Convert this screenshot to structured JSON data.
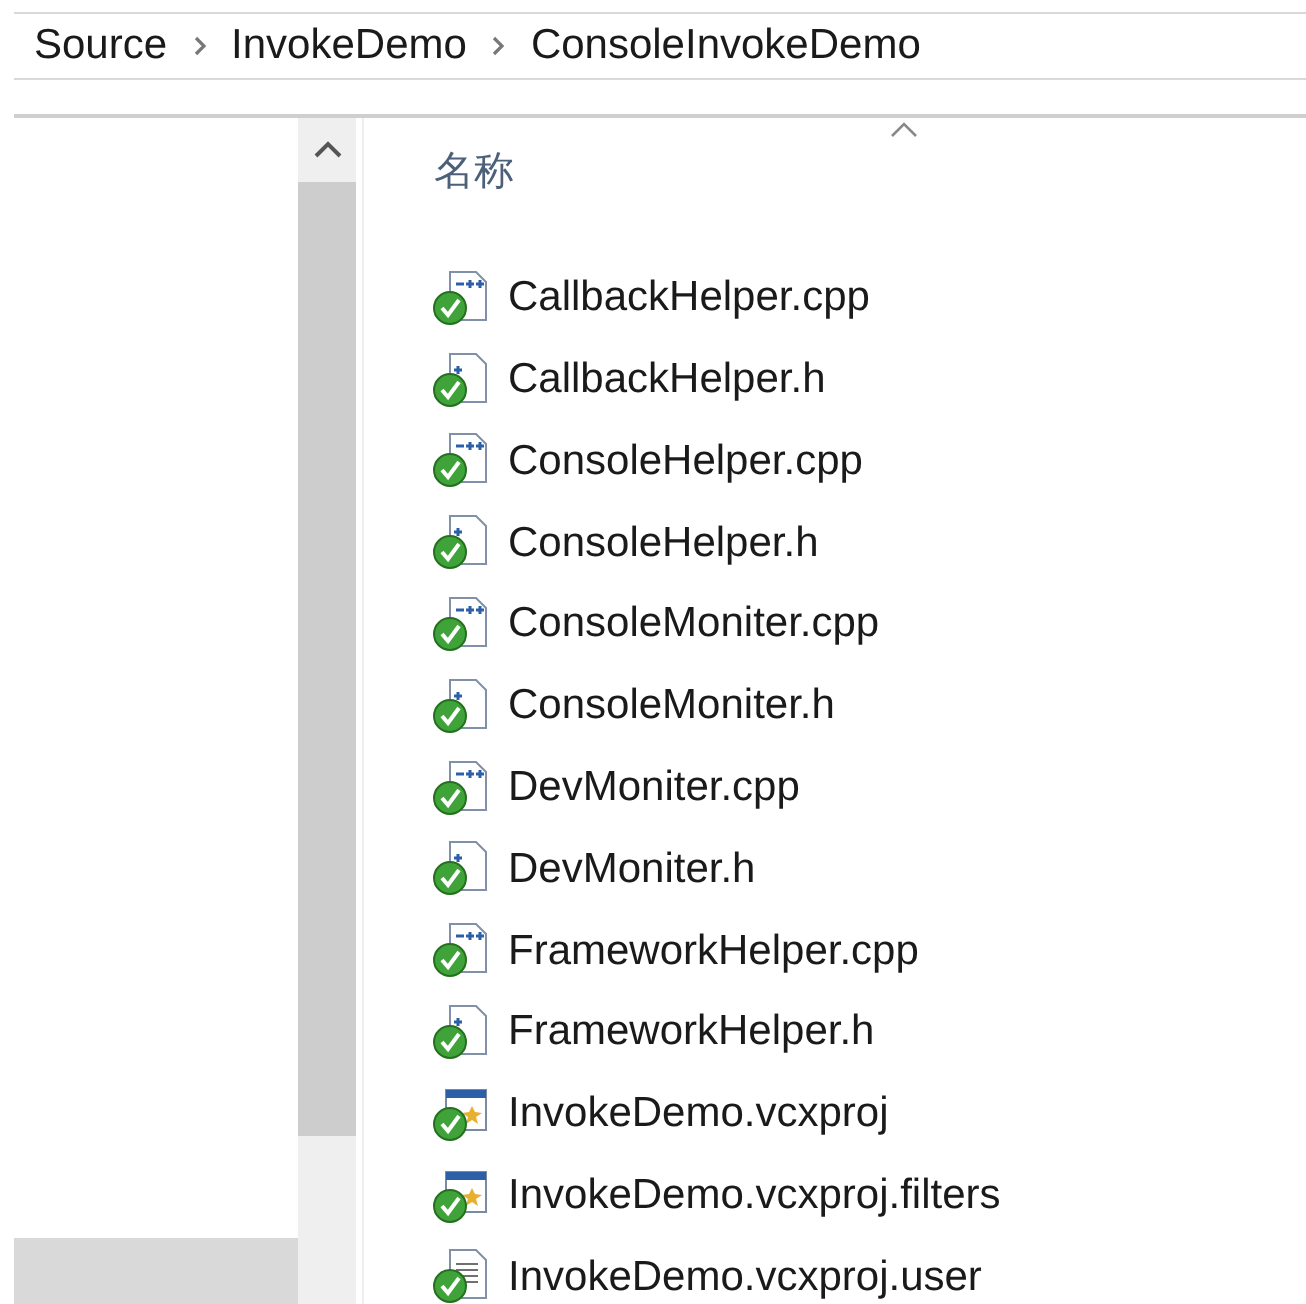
{
  "breadcrumb": [
    "Source",
    "InvokeDemo",
    "ConsoleInvokeDemo"
  ],
  "file_list": {
    "column_header": "名称",
    "files": [
      {
        "name": "CallbackHelper.cpp",
        "kind": "cpp"
      },
      {
        "name": "CallbackHelper.h",
        "kind": "h"
      },
      {
        "name": "ConsoleHelper.cpp",
        "kind": "cpp"
      },
      {
        "name": "ConsoleHelper.h",
        "kind": "h"
      },
      {
        "name": "ConsoleMoniter.cpp",
        "kind": "cpp"
      },
      {
        "name": "ConsoleMoniter.h",
        "kind": "h"
      },
      {
        "name": "DevMoniter.cpp",
        "kind": "cpp"
      },
      {
        "name": "DevMoniter.h",
        "kind": "h"
      },
      {
        "name": "FrameworkHelper.cpp",
        "kind": "cpp"
      },
      {
        "name": "FrameworkHelper.h",
        "kind": "h"
      },
      {
        "name": "InvokeDemo.vcxproj",
        "kind": "project"
      },
      {
        "name": "InvokeDemo.vcxproj.filters",
        "kind": "project"
      },
      {
        "name": "InvokeDemo.vcxproj.user",
        "kind": "user"
      }
    ]
  }
}
